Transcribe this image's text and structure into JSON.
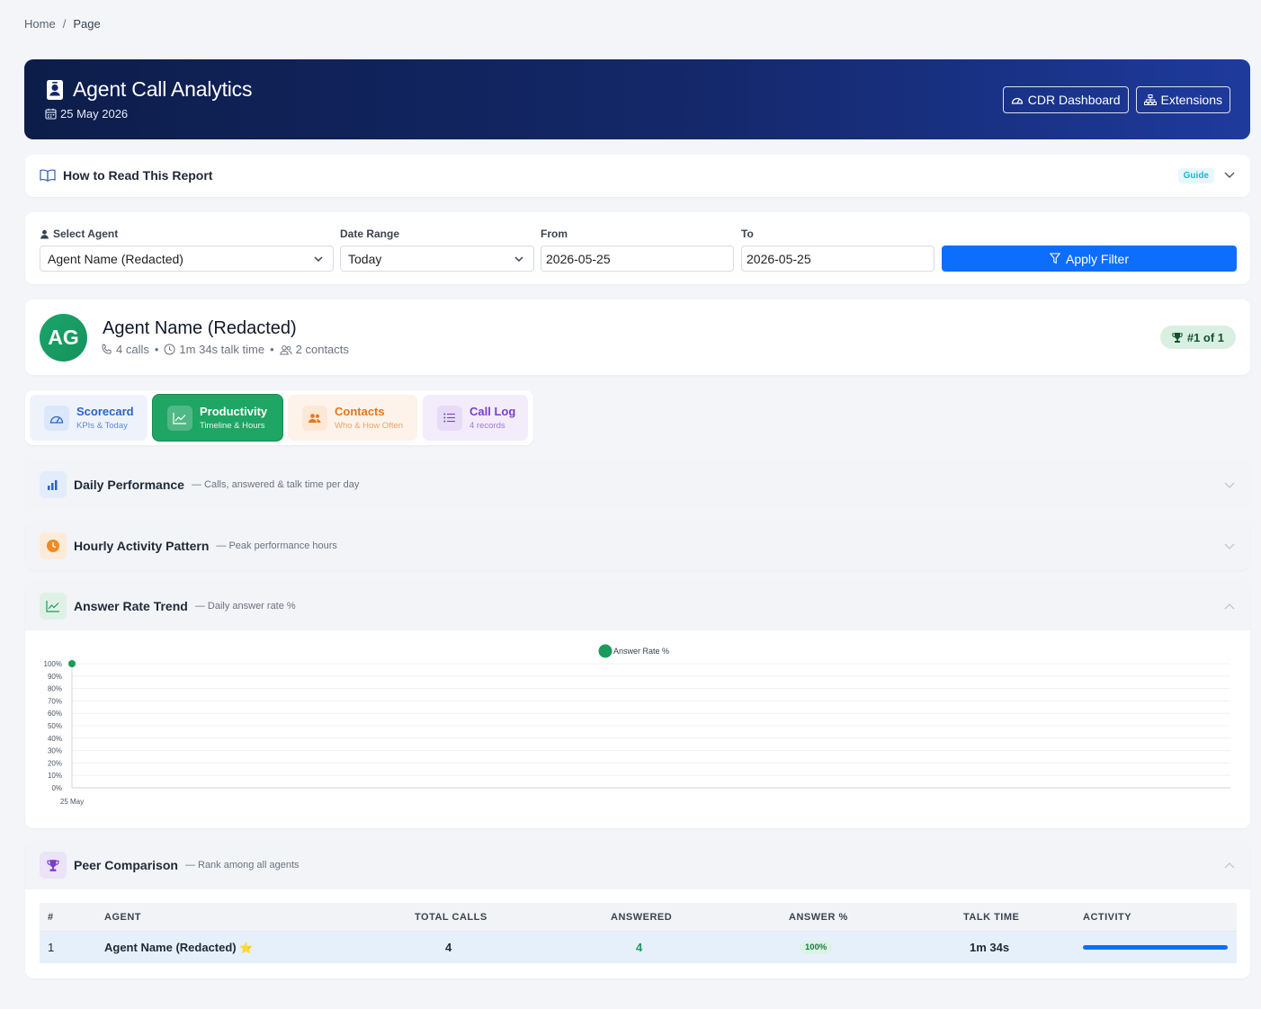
{
  "breadcrumb": {
    "home": "Home",
    "separator": "/",
    "current": "Page"
  },
  "header": {
    "title": "Agent Call Analytics",
    "date": "25 May 2026",
    "buttons": {
      "cdr": "CDR Dashboard",
      "extensions": "Extensions"
    }
  },
  "guide": {
    "title": "How to Read This Report",
    "badge": "Guide"
  },
  "filters": {
    "agent_label": "Select Agent",
    "agent_value": "Agent Name (Redacted)",
    "range_label": "Date Range",
    "range_value": "Today",
    "from_label": "From",
    "from_value": "2026-05-25",
    "to_label": "To",
    "to_value": "2026-05-25",
    "apply_label": "Apply Filter"
  },
  "agent": {
    "initials": "AG",
    "name": "Agent Name (Redacted)",
    "calls": "4 calls",
    "talk_time": "1m 34s talk time",
    "contacts": "2 contacts",
    "dot": "•",
    "rank": "#1 of 1"
  },
  "tabs": [
    {
      "title": "Scorecard",
      "subtitle": "KPIs & Today"
    },
    {
      "title": "Productivity",
      "subtitle": "Timeline & Hours"
    },
    {
      "title": "Contacts",
      "subtitle": "Who & How Often"
    },
    {
      "title": "Call Log",
      "subtitle": "4 records"
    }
  ],
  "sections": {
    "daily": {
      "title": "Daily Performance",
      "subtitle": "— Calls, answered & talk time per day"
    },
    "hourly": {
      "title": "Hourly Activity Pattern",
      "subtitle": "— Peak performance hours"
    },
    "answer": {
      "title": "Answer Rate Trend",
      "subtitle": "— Daily answer rate %"
    },
    "peer": {
      "title": "Peer Comparison",
      "subtitle": "— Rank among all agents"
    }
  },
  "chart_data": {
    "type": "line",
    "categories": [
      "25 May"
    ],
    "series": [
      {
        "name": "Answer Rate %",
        "values": [
          100
        ],
        "color": "#1a9a5c"
      }
    ],
    "yticks": [
      "0%",
      "10%",
      "20%",
      "30%",
      "40%",
      "50%",
      "60%",
      "70%",
      "80%",
      "90%",
      "100%"
    ],
    "ylim": [
      0,
      100
    ],
    "legend": "top-center",
    "grid": true
  },
  "peer_table": {
    "headers": [
      "#",
      "AGENT",
      "TOTAL CALLS",
      "ANSWERED",
      "ANSWER %",
      "TALK TIME",
      "ACTIVITY"
    ],
    "rows": [
      {
        "rank": "1",
        "agent": "Agent Name (Redacted)",
        "star": "⭐",
        "total": "4",
        "answered": "4",
        "pct": "100%",
        "talk": "1m 34s",
        "activity": 1.0
      }
    ]
  },
  "colors": {
    "primary": "#0d6efd",
    "success": "#1fa564",
    "header_dark": "#0d1d4a"
  }
}
